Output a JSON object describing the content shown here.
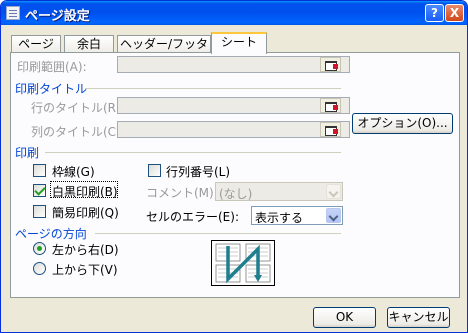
{
  "window": {
    "title": "ページ設定"
  },
  "title_buttons": {
    "help": "?",
    "close": "X"
  },
  "tabs": [
    "ページ",
    "余白",
    "ヘッダー/フッター",
    "シート"
  ],
  "print_area": {
    "label": "印刷範囲(A):"
  },
  "print_titles": {
    "section": "印刷タイトル",
    "rows_label": "行のタイトル(R):",
    "cols_label": "列のタイトル(C):"
  },
  "options_button": "オプション(O)...",
  "print": {
    "section": "印刷",
    "gridlines": {
      "label": "枠線(G)",
      "checked": false
    },
    "black_white": {
      "label": "白黒印刷(B)",
      "checked": true
    },
    "draft": {
      "label": "簡易印刷(Q)",
      "checked": false
    },
    "row_col_headers": {
      "label": "行列番号(L)",
      "checked": false
    },
    "comments_label": "コメント(M):",
    "comments_value": "(なし)",
    "errors_label": "セルのエラー(E):",
    "errors_value": "表示する"
  },
  "page_order": {
    "section": "ページの方向",
    "down_then_over": {
      "label": "左から右(D)",
      "checked": true
    },
    "over_then_down": {
      "label": "上から下(V)",
      "checked": false
    }
  },
  "footer": {
    "ok": "OK",
    "cancel": "キャンセル"
  },
  "colors": {
    "section": "#0046d5",
    "title_bar": "#0053ee",
    "arrow": "#1f7f8f"
  }
}
